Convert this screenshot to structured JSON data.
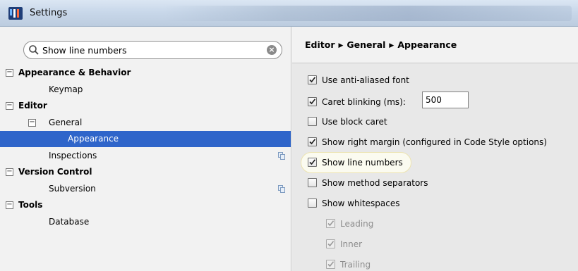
{
  "window": {
    "title": "Settings"
  },
  "search": {
    "value": "Show line numbers"
  },
  "tree": [
    {
      "label": "Appearance & Behavior",
      "level": 0,
      "bold": true,
      "toggle": "−",
      "selected": false,
      "copy": false
    },
    {
      "label": "Keymap",
      "level": 1,
      "bold": false,
      "toggle": "",
      "selected": false,
      "copy": false
    },
    {
      "label": "Editor",
      "level": 0,
      "bold": true,
      "toggle": "−",
      "selected": false,
      "copy": false
    },
    {
      "label": "General",
      "level": 1,
      "bold": false,
      "toggle": "−",
      "selected": false,
      "copy": false
    },
    {
      "label": "Appearance",
      "level": 2,
      "bold": false,
      "toggle": "",
      "selected": true,
      "copy": false
    },
    {
      "label": "Inspections",
      "level": 1,
      "bold": false,
      "toggle": "",
      "selected": false,
      "copy": true
    },
    {
      "label": "Version Control",
      "level": 0,
      "bold": true,
      "toggle": "−",
      "selected": false,
      "copy": false
    },
    {
      "label": "Subversion",
      "level": 1,
      "bold": false,
      "toggle": "",
      "selected": false,
      "copy": true
    },
    {
      "label": "Tools",
      "level": 0,
      "bold": true,
      "toggle": "−",
      "selected": false,
      "copy": false
    },
    {
      "label": "Database",
      "level": 1,
      "bold": false,
      "toggle": "",
      "selected": false,
      "copy": false
    }
  ],
  "breadcrumb": [
    "Editor",
    "General",
    "Appearance"
  ],
  "options": [
    {
      "label": "Use anti-aliased font",
      "checked": true,
      "disabled": false,
      "indent": 0
    },
    {
      "label": "Caret blinking (ms):",
      "checked": true,
      "disabled": false,
      "indent": 0,
      "input": "500"
    },
    {
      "label": "Use block caret",
      "checked": false,
      "disabled": false,
      "indent": 0
    },
    {
      "label": "Show right margin (configured in Code Style options)",
      "checked": true,
      "disabled": false,
      "indent": 0
    },
    {
      "label": "Show line numbers",
      "checked": true,
      "disabled": false,
      "indent": 0,
      "highlight": true
    },
    {
      "label": "Show method separators",
      "checked": false,
      "disabled": false,
      "indent": 0
    },
    {
      "label": "Show whitespaces",
      "checked": false,
      "disabled": false,
      "indent": 0
    },
    {
      "label": "Leading",
      "checked": true,
      "disabled": true,
      "indent": 1
    },
    {
      "label": "Inner",
      "checked": true,
      "disabled": true,
      "indent": 1
    },
    {
      "label": "Trailing",
      "checked": true,
      "disabled": true,
      "indent": 1
    }
  ],
  "colors": {
    "selection": "#2f65ca",
    "highlight": "#fbfbf0"
  }
}
